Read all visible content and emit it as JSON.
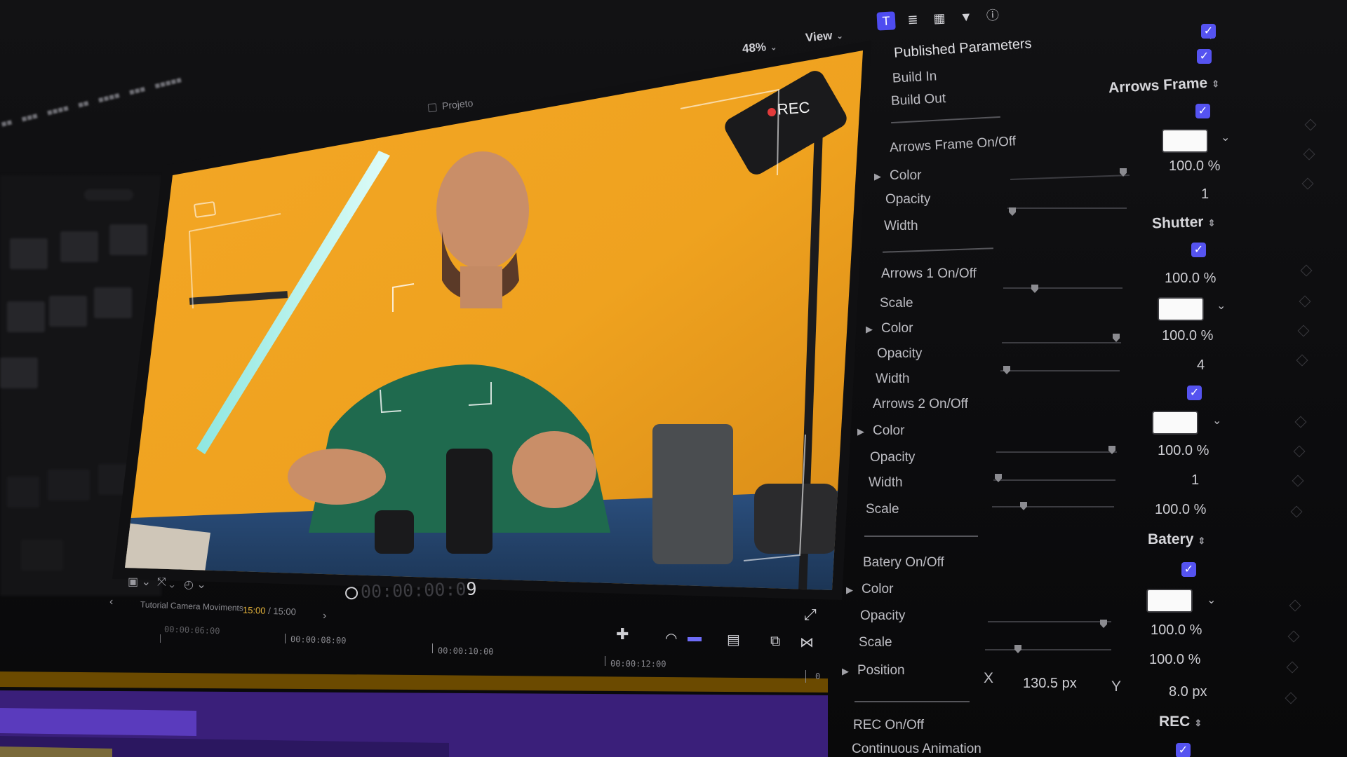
{
  "viewer": {
    "project_title": "Projeto",
    "zoom": "48%",
    "view_menu": "View",
    "overlay_rec": "REC",
    "timecode_dim": "00:00:00:0",
    "timecode_live": "9"
  },
  "timeline": {
    "project_name": "Tutorial Camera Moviments",
    "duration_current": "15:00",
    "duration_total": "/ 15:00",
    "ruler": [
      "00:00:06:00",
      "00:00:08:00",
      "00:00:10:00",
      "00:00:12:00",
      "0"
    ]
  },
  "inspector": {
    "section_title": "Published Parameters",
    "build_in": "Build In",
    "build_out": "Build Out",
    "groups": [
      {
        "name": "Arrows Frame",
        "rows": [
          {
            "label": "Arrows Frame On/Off",
            "type": "check"
          },
          {
            "label": "Color",
            "type": "color",
            "disclosure": "▶"
          },
          {
            "label": "Opacity",
            "type": "slider",
            "value": "100.0",
            "unit": "%"
          },
          {
            "label": "Width",
            "type": "slider",
            "value": "1",
            "unit": ""
          }
        ]
      },
      {
        "name": "Shutter",
        "rows": [
          {
            "label": "Arrows 1 On/Off",
            "type": "check"
          },
          {
            "label": "Scale",
            "type": "slider",
            "value": "100.0",
            "unit": "%"
          },
          {
            "label": "Color",
            "type": "color",
            "disclosure": "▶"
          },
          {
            "label": "Opacity",
            "type": "slider",
            "value": "100.0",
            "unit": "%"
          },
          {
            "label": "Width",
            "type": "slider",
            "value": "4",
            "unit": ""
          },
          {
            "label": "Arrows 2 On/Off",
            "type": "check"
          },
          {
            "label": "Color",
            "type": "color",
            "disclosure": "▶"
          },
          {
            "label": "Opacity",
            "type": "slider",
            "value": "100.0",
            "unit": "%"
          },
          {
            "label": "Width",
            "type": "slider",
            "value": "1",
            "unit": ""
          },
          {
            "label": "Scale",
            "type": "slider",
            "value": "100.0",
            "unit": "%"
          }
        ]
      },
      {
        "name": "Batery",
        "rows": [
          {
            "label": "Batery On/Off",
            "type": "check"
          },
          {
            "label": "Color",
            "type": "color",
            "disclosure": "▶"
          },
          {
            "label": "Opacity",
            "type": "slider",
            "value": "100.0",
            "unit": "%"
          },
          {
            "label": "Scale",
            "type": "slider",
            "value": "100.0",
            "unit": "%"
          },
          {
            "label": "Position",
            "type": "position",
            "disclosure": "▶",
            "x_label": "X",
            "x_value": "130.5 px",
            "y_label": "Y",
            "y_value": "8.0 px"
          }
        ]
      },
      {
        "name": "REC",
        "rows": [
          {
            "label": "REC On/Off",
            "type": "check"
          },
          {
            "label": "Continuous Animation",
            "type": "check"
          }
        ]
      }
    ]
  },
  "colors": {
    "accent": "#5553f0",
    "backdrop": "#f2a31e",
    "shirt": "#1f6a4e",
    "table": "#2a4c7a",
    "timeline_purple": "#4a2a9a",
    "timecode_yellow": "#e5b33b"
  },
  "icons": [
    "cursor-arrow-icon",
    "info-icon",
    "filter-icon",
    "film-icon",
    "list-icon",
    "title-icon",
    "fullscreen-icon",
    "headphones-icon",
    "blade-icon",
    "transitions-icon"
  ]
}
